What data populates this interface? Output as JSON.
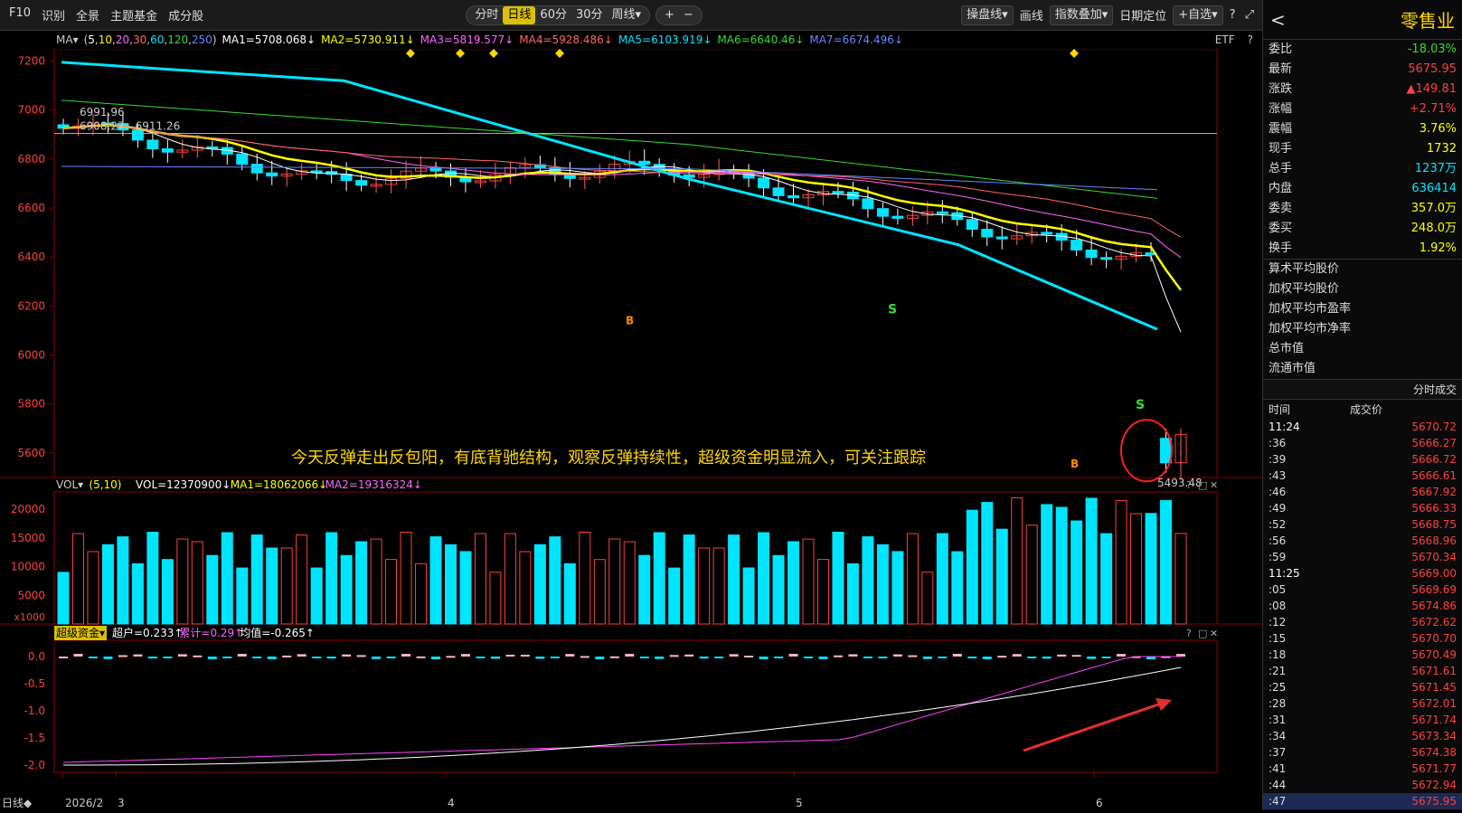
{
  "toolbar": {
    "left": [
      "F10",
      "识别",
      "全景",
      "主题基金",
      "成分股"
    ],
    "periods": [
      "分时",
      "日线",
      "60分",
      "30分",
      "周线▾"
    ],
    "active_period": 1,
    "zoom": [
      "+",
      "−"
    ],
    "right": [
      "操盘线▾",
      "画线",
      "指数叠加▾",
      "日期定位",
      "+自选▾",
      "?",
      "⤢"
    ]
  },
  "ma_row": {
    "label": "MA▾",
    "params_open": "(",
    "params": [
      "5",
      "10",
      "20",
      "30",
      "60",
      "120",
      "250"
    ],
    "params_close": ")",
    "items": [
      {
        "text": "MA1=5708.068↓",
        "color": "#ffffff"
      },
      {
        "text": "MA2=5730.911↓",
        "color": "#ffff00"
      },
      {
        "text": "MA3=5819.577↓",
        "color": "#ff66ff"
      },
      {
        "text": "MA4=5928.486↓",
        "color": "#ff6666"
      },
      {
        "text": "MA5=6103.919↓",
        "color": "#00e5ff"
      },
      {
        "text": "MA6=6640.46↓",
        "color": "#33dd33"
      },
      {
        "text": "MA7=6674.496↓",
        "color": "#6688ff"
      }
    ],
    "right_label": "ETF",
    "help": "?"
  },
  "price_axis": [
    "7200",
    "7000",
    "6800",
    "6600",
    "6400",
    "6200",
    "6000",
    "5800",
    "5600"
  ],
  "price_labels": {
    "hi": "6991.96",
    "hi_range": "6908.27 - 6911.26",
    "lo": "5493.48"
  },
  "annotation": "今天反弹走出反包阳，有底背驰结构，观察反弹持续性，超级资金明显流入，可关注跟踪",
  "signals": {
    "b1": "B",
    "b2": "B",
    "s1": "S",
    "s2": "S"
  },
  "vol_row": {
    "label": "VOL▾",
    "params": "(5,10)",
    "items": [
      {
        "text": "VOL=12370900↓",
        "color": "#ffffff"
      },
      {
        "text": "MA1=18062066↓",
        "color": "#ffff00"
      },
      {
        "text": "MA2=19316324↓",
        "color": "#ff66ff"
      }
    ],
    "axis": [
      "20000",
      "15000",
      "10000",
      "5000"
    ],
    "unit": "x1000",
    "icons": [
      "?",
      "□",
      "✕"
    ]
  },
  "fund_row": {
    "label": "超级资金▾",
    "items": [
      {
        "text": "超户=0.233↑",
        "color": "#ffffff"
      },
      {
        "text": "累计=0.29↑",
        "color": "#ff66ff"
      },
      {
        "text": "均值=-0.265↑",
        "color": "#ffffff"
      }
    ],
    "axis": [
      "0.0",
      "-0.5",
      "-1.0",
      "-1.5",
      "-2.0"
    ],
    "icons": [
      "?",
      "□",
      "✕"
    ]
  },
  "date_axis": {
    "label": "日线◆",
    "ticks": [
      "2026/2",
      "3",
      "4",
      "5",
      "6"
    ]
  },
  "panel": {
    "title": "零售业",
    "back": "<",
    "quote": [
      {
        "k": "委比",
        "v": "-18.03%",
        "c": "#33dd33"
      },
      {
        "k": "最新",
        "v": "5675.95",
        "c": "#ff4040"
      },
      {
        "k": "涨跌",
        "v": "▲149.81",
        "c": "#ff4040"
      },
      {
        "k": "涨幅",
        "v": "+2.71%",
        "c": "#ff4040"
      },
      {
        "k": "震幅",
        "v": "3.76%",
        "c": "#ffff00"
      },
      {
        "k": "现手",
        "v": "1732",
        "c": "#ffff00"
      },
      {
        "k": "总手",
        "v": "1237万",
        "c": "#00e5ff"
      },
      {
        "k": "内盘",
        "v": "636414",
        "c": "#00e5ff"
      },
      {
        "k": "委卖",
        "v": "357.0万",
        "c": "#ffff00"
      },
      {
        "k": "委买",
        "v": "248.0万",
        "c": "#ffff00"
      },
      {
        "k": "换手",
        "v": "1.92%",
        "c": "#ffff00"
      }
    ],
    "stats": [
      "算术平均股价",
      "加权平均股价",
      "加权平均市盈率",
      "加权平均市净率",
      "总市值",
      "流通市值"
    ],
    "tick_title": "分时成交",
    "tick_cols": [
      "时间",
      "成交价"
    ],
    "ticks": [
      {
        "t": "11:24",
        "p": "5670.72"
      },
      {
        "t": ":36",
        "p": "5666.27"
      },
      {
        "t": ":39",
        "p": "5666.72"
      },
      {
        "t": ":43",
        "p": "5666.61"
      },
      {
        "t": ":46",
        "p": "5667.92"
      },
      {
        "t": ":49",
        "p": "5666.33"
      },
      {
        "t": ":52",
        "p": "5668.75"
      },
      {
        "t": ":56",
        "p": "5668.96"
      },
      {
        "t": ":59",
        "p": "5670.34"
      },
      {
        "t": "11:25",
        "p": "5669.00"
      },
      {
        "t": ":05",
        "p": "5669.69"
      },
      {
        "t": ":08",
        "p": "5674.86"
      },
      {
        "t": ":12",
        "p": "5672.62"
      },
      {
        "t": ":15",
        "p": "5670.70"
      },
      {
        "t": ":18",
        "p": "5670.49"
      },
      {
        "t": ":21",
        "p": "5671.61"
      },
      {
        "t": ":25",
        "p": "5671.45"
      },
      {
        "t": ":28",
        "p": "5672.01"
      },
      {
        "t": ":31",
        "p": "5671.74"
      },
      {
        "t": ":34",
        "p": "5673.34"
      },
      {
        "t": ":37",
        "p": "5674.38"
      },
      {
        "t": ":41",
        "p": "5671.77"
      },
      {
        "t": ":44",
        "p": "5672.94"
      },
      {
        "t": ":47",
        "p": "5675.95"
      }
    ]
  }
}
